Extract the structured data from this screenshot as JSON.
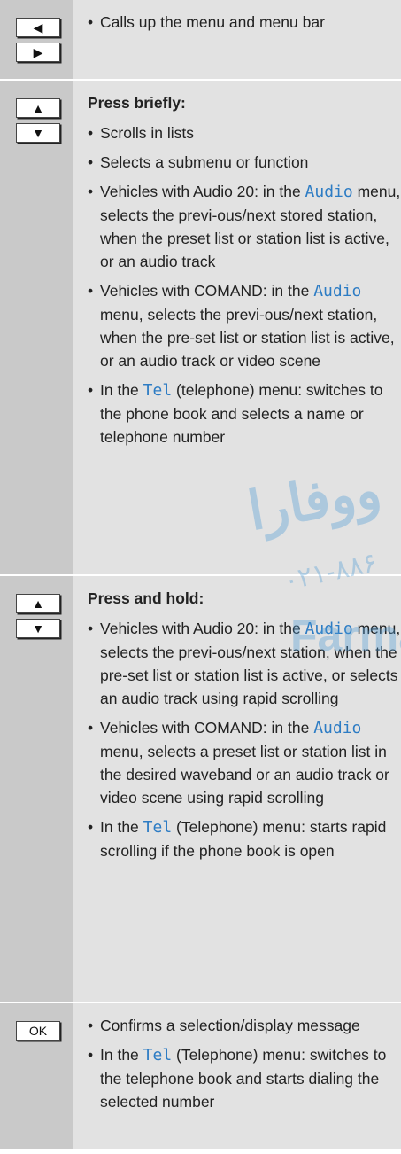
{
  "rows": [
    {
      "keys": [
        "◀",
        "▶"
      ],
      "key_icons": [
        "left-arrow-key-icon",
        "right-arrow-key-icon"
      ],
      "heading": "",
      "items": [
        {
          "segments": [
            {
              "text": "Calls up the menu and menu bar"
            }
          ]
        }
      ]
    },
    {
      "keys": [
        "▲",
        "▼"
      ],
      "key_icons": [
        "up-arrow-key-icon",
        "down-arrow-key-icon"
      ],
      "heading": "Press briefly:",
      "items": [
        {
          "segments": [
            {
              "text": "Scrolls in lists"
            }
          ]
        },
        {
          "segments": [
            {
              "text": "Selects a submenu or function"
            }
          ]
        },
        {
          "segments": [
            {
              "text": "Vehicles with Audio 20: in the "
            },
            {
              "text": "Audio",
              "code": true
            },
            {
              "text": " menu, selects the previ-ous/next stored station, when the preset list or station list is active, or an audio track"
            }
          ]
        },
        {
          "segments": [
            {
              "text": "Vehicles with COMAND: in the "
            },
            {
              "text": "Audio",
              "code": true
            },
            {
              "text": " menu, selects the previ-ous/next station, when the pre-set list or station list is active, or an audio track or video scene"
            }
          ]
        },
        {
          "segments": [
            {
              "text": "In the "
            },
            {
              "text": "Tel",
              "code": true
            },
            {
              "text": " (telephone) menu: switches to the phone book and selects a name or telephone number"
            }
          ]
        }
      ]
    },
    {
      "keys": [
        "▲",
        "▼"
      ],
      "key_icons": [
        "up-arrow-key-icon",
        "down-arrow-key-icon"
      ],
      "heading": "Press and hold:",
      "items": [
        {
          "segments": [
            {
              "text": "Vehicles with Audio 20: in the "
            },
            {
              "text": "Audio",
              "code": true
            },
            {
              "text": " menu, selects the previ-ous/next station, when the pre-set list or station list is active, or selects an audio track using rapid scrolling"
            }
          ]
        },
        {
          "segments": [
            {
              "text": "Vehicles with COMAND: in the "
            },
            {
              "text": "Audio",
              "code": true
            },
            {
              "text": " menu, selects a preset list or station list in the desired waveband or an audio track or video scene using rapid scrolling"
            }
          ]
        },
        {
          "segments": [
            {
              "text": "In the "
            },
            {
              "text": "Tel",
              "code": true
            },
            {
              "text": " (Telephone) menu: starts rapid scrolling if the phone book is open"
            }
          ]
        }
      ]
    },
    {
      "keys": [
        "OK"
      ],
      "key_icons": [
        "ok-key-icon"
      ],
      "heading": "",
      "items": [
        {
          "segments": [
            {
              "text": "Confirms a selection/display message"
            }
          ]
        },
        {
          "segments": [
            {
              "text": "In the "
            },
            {
              "text": "Tel",
              "code": true
            },
            {
              "text": " (Telephone) menu: switches to the telephone book and starts dialing the selected number"
            }
          ]
        }
      ]
    }
  ],
  "watermark": {
    "arabic": "ووفارا",
    "digits": "۰۲۱-۸۸۶",
    "latin": "Farma"
  }
}
